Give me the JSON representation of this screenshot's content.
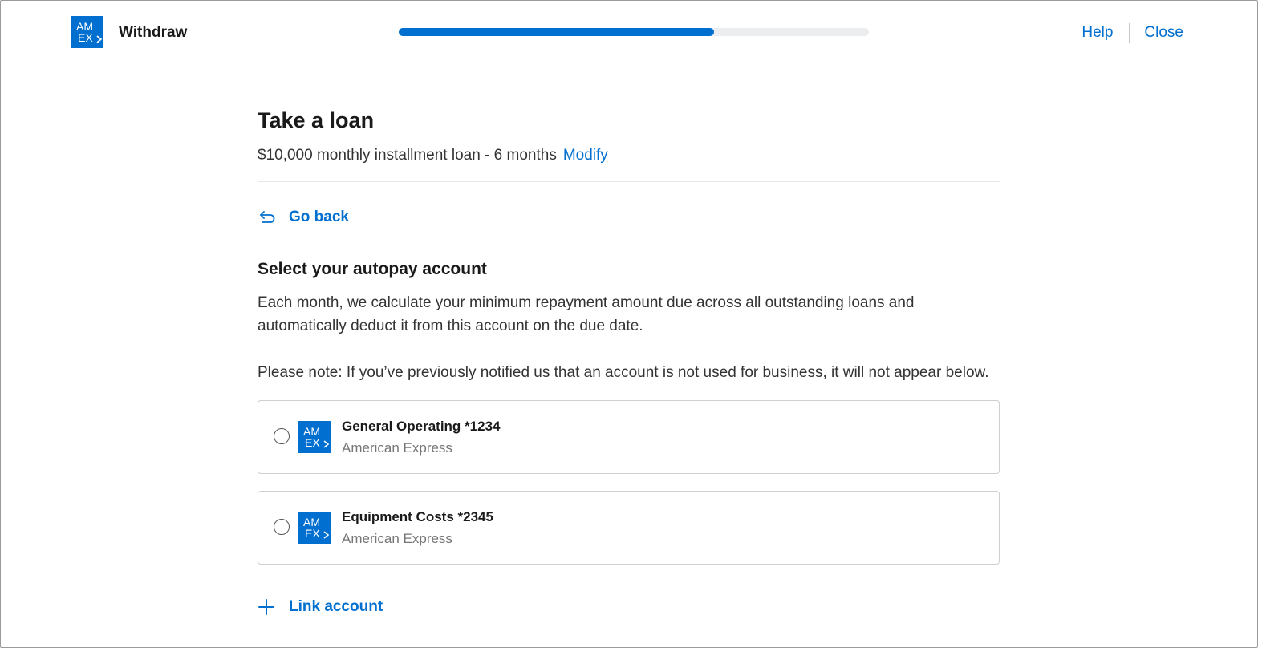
{
  "header": {
    "logo_alt_text": "AM EX",
    "title": "Withdraw",
    "progress_fraction": 0.67,
    "help_label": "Help",
    "close_label": "Close"
  },
  "main": {
    "title": "Take a loan",
    "loan_summary": "$10,000 monthly installment loan - 6 months",
    "modify_label": "Modify",
    "go_back_label": "Go back",
    "section_title": "Select your autopay account",
    "description": "Each month, we calculate your minimum repayment amount due across all outstanding loans and automatically deduct it from this account on the due date.",
    "note": "Please note: If you’ve previously notified us that an account is not used for business, it will not appear below.",
    "accounts": [
      {
        "name": "General Operating *1234",
        "bank": "American Express",
        "selected": false
      },
      {
        "name": "Equipment Costs *2345",
        "bank": "American Express",
        "selected": false
      }
    ],
    "link_account_label": "Link account"
  },
  "colors": {
    "accent": "#006fcf",
    "progress_track": "#ecedee",
    "text_primary": "#1a1a1a",
    "text_secondary": "#767676"
  },
  "icons": {
    "brand": "amex-logo-icon",
    "back": "return-arrow-icon",
    "add": "plus-icon",
    "radio": "radio-unchecked-icon"
  }
}
